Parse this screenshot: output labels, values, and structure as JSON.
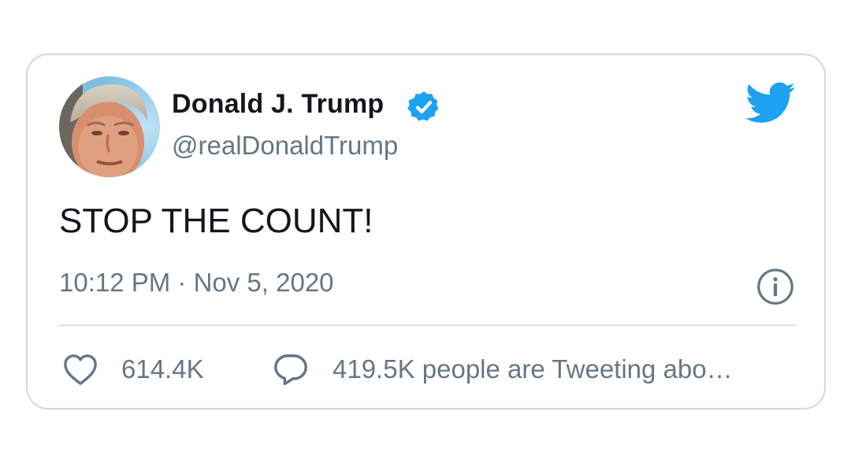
{
  "tweet": {
    "author_name": "Donald J. Trump",
    "author_handle": "@realDonaldTrump",
    "verified": true,
    "text": "STOP THE COUNT!",
    "timestamp": "10:12 PM · Nov 5, 2020",
    "like_count": "614.4K",
    "conversation_text": "419.5K people are Tweeting abo…"
  },
  "icons": {
    "brand": "twitter-bird-icon",
    "verified": "verified-badge-icon",
    "info": "info-icon",
    "like": "heart-icon",
    "reply": "reply-bubble-icon"
  },
  "colors": {
    "accent": "#1da1f2",
    "primary_text": "#14171a",
    "secondary_text": "#657786",
    "border": "#cfd9de"
  }
}
